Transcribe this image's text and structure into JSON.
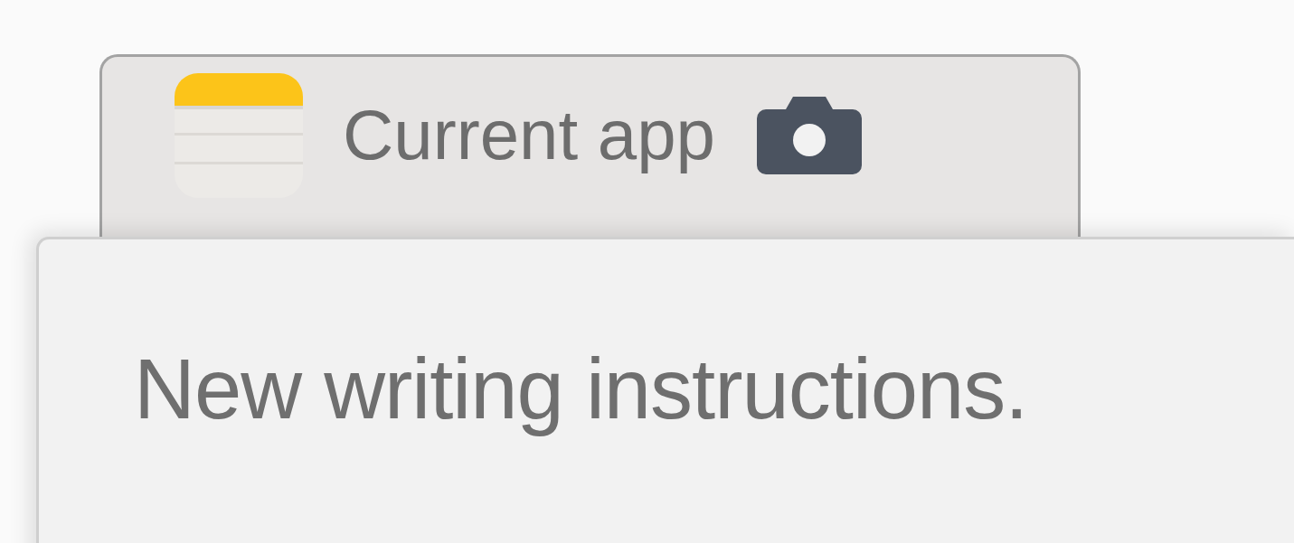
{
  "tab": {
    "label": "Current app"
  },
  "editor": {
    "text": "New writing instructions."
  }
}
